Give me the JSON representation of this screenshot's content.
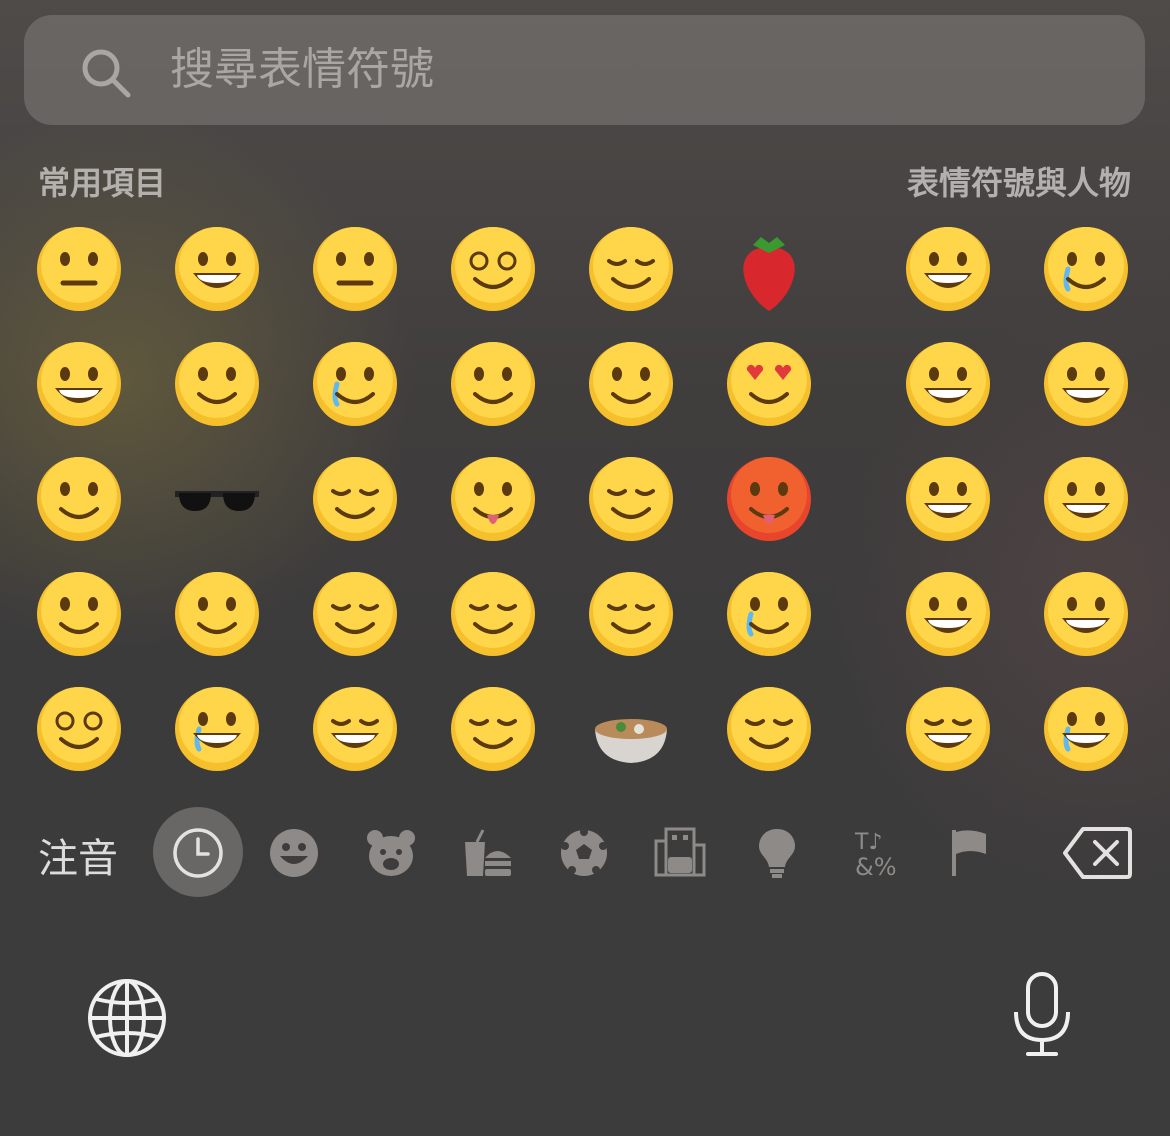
{
  "search": {
    "placeholder": "搜尋表情符號"
  },
  "sections": {
    "recent": "常用項目",
    "smileys": "表情符號與人物"
  },
  "recent_emojis": [
    [
      "neutral-face",
      "rolling-laughing",
      "expressionless",
      "dizzy-face",
      "downcast-sweat",
      "strawberry"
    ],
    [
      "tears-of-joy",
      "screaming",
      "pleading",
      "slightly-smiling",
      "smiling-hearts",
      "heart-eyes"
    ],
    [
      "thinking",
      "sunglasses",
      "relieved",
      "tongue-out",
      "partying",
      "hot-face"
    ],
    [
      "melting",
      "hand-over-mouth",
      "drooling",
      "steam-nose",
      "kissing-smiling-eyes",
      "loudly-crying"
    ],
    [
      "spiral-eyes",
      "holding-back-tears",
      "grinning-squint",
      "exhale",
      "stew",
      "sleeping"
    ]
  ],
  "smileys_emojis": [
    [
      "grinning",
      "pleading"
    ],
    [
      "smiley",
      "sweat-smile"
    ],
    [
      "grin",
      "tears-of-joy"
    ],
    [
      "grin",
      "rolling-laughing"
    ],
    [
      "grinning-squint",
      "holding-back-tears"
    ]
  ],
  "toolbar": {
    "language_label": "注音",
    "categories": [
      "clock-icon",
      "smiley-icon",
      "bear-icon",
      "food-icon",
      "ball-icon",
      "building-icon",
      "bulb-icon",
      "symbols-icon",
      "flag-icon"
    ]
  },
  "colors": {
    "accent": "#f5b722",
    "background": "#403d3d"
  }
}
